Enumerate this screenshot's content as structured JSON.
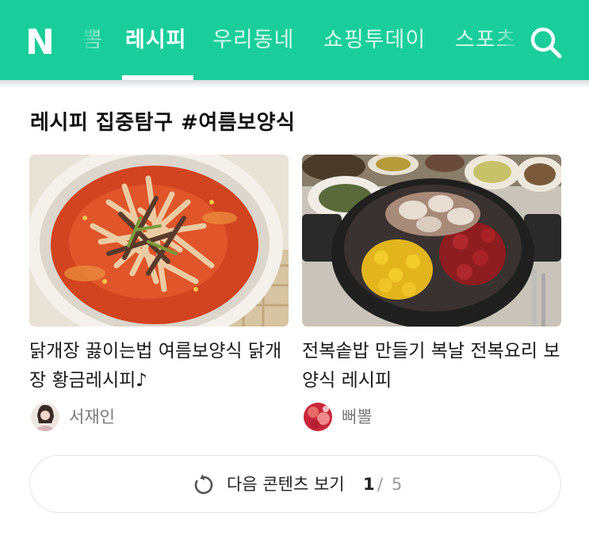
{
  "header": {
    "logo": "N",
    "tabs": [
      {
        "label": "뽐",
        "active": false
      },
      {
        "label": "레시피",
        "active": true
      },
      {
        "label": "우리동네",
        "active": false
      },
      {
        "label": "쇼핑투데이",
        "active": false
      },
      {
        "label": "스포츠",
        "active": false
      }
    ],
    "brand_color": "#19ce9a",
    "search_icon": "search-icon"
  },
  "section": {
    "title": "레시피 집중탐구 #여름보양식"
  },
  "cards": [
    {
      "title": "닭개장 끓이는법 여름보양식 닭개장 황금레시피♪",
      "author": "서재인",
      "image": "spicy-chicken-soup-photo"
    },
    {
      "title": "전복솥밥 만들기 복날 전복요리 보양식 레시피",
      "author": "뻐뽈",
      "image": "abalone-pot-rice-photo"
    }
  ],
  "more": {
    "label": "다음 콘텐츠 보기",
    "current": "1",
    "separator": "/",
    "total": "5",
    "icon": "refresh-icon"
  }
}
